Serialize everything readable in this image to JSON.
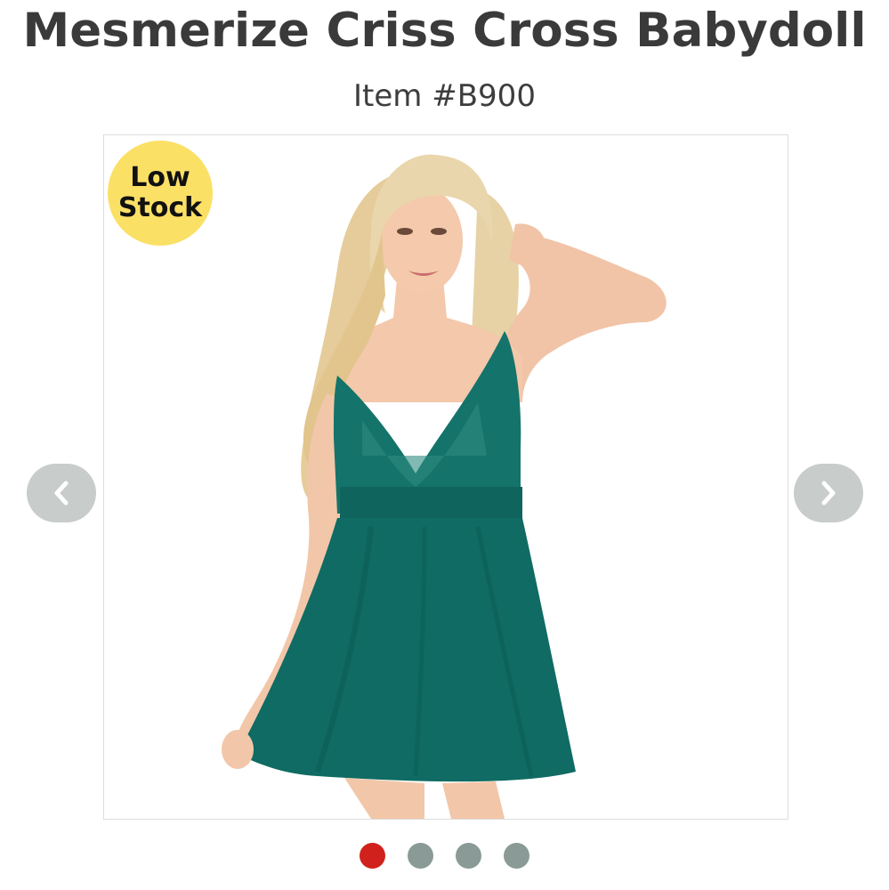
{
  "product": {
    "title": "Mesmerize Criss Cross Babydoll",
    "item_number": "Item #B900",
    "badge_line1": "Low",
    "badge_line2": "Stock"
  },
  "gallery": {
    "prev_icon": "chevron-left-icon",
    "next_icon": "chevron-right-icon",
    "dot_count": 4,
    "active_index": 0
  },
  "colors": {
    "badge": "#fbe066",
    "active_dot": "#d0211c",
    "inactive_dot": "#8a9a96",
    "garment": "#0f6b63",
    "arrow_bg": "#c8ccca"
  }
}
